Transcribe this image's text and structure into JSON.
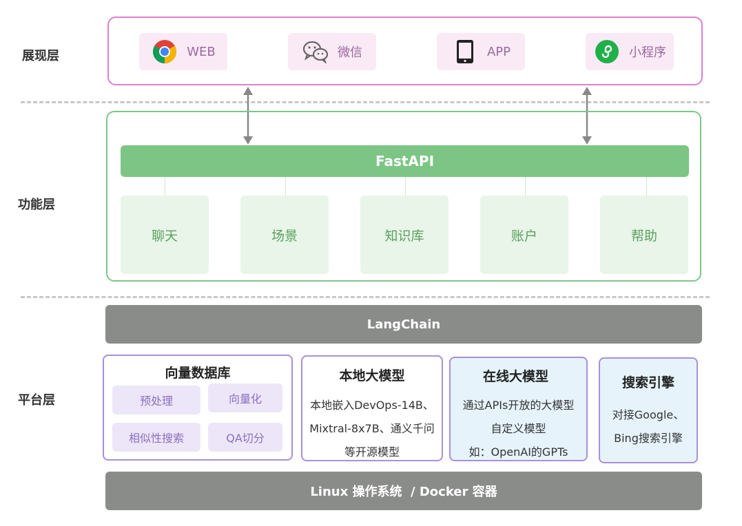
{
  "layers": {
    "presentation": "展现层",
    "function": "功能层",
    "platform": "平台层"
  },
  "presentation": {
    "clients": [
      {
        "label": "WEB",
        "icon": "chrome-icon"
      },
      {
        "label": "微信",
        "icon": "wechat-icon"
      },
      {
        "label": "APP",
        "icon": "mobile-phone-icon"
      },
      {
        "label": "小程序",
        "icon": "mini-program-icon"
      }
    ]
  },
  "function": {
    "api": "FastAPI",
    "modules": [
      "聊天",
      "场景",
      "知识库",
      "账户",
      "帮助"
    ]
  },
  "framework": "LangChain",
  "platform": {
    "vector_db": {
      "title": "向量数据库",
      "items": [
        "预处理",
        "向量化",
        "相似性搜索",
        "QA切分"
      ]
    },
    "local_model": {
      "title": "本地大模型",
      "lines": [
        "本地嵌入DevOps-14B、",
        "Mixtral-8x7B、通义千问",
        "等开源模型"
      ]
    },
    "online_model": {
      "title": "在线大模型",
      "lines": [
        "通过APIs开放的大模型",
        "自定义模型",
        "如：OpenAI的GPTs"
      ]
    },
    "search_engine": {
      "title": "搜索引擎",
      "lines": [
        "对接Google、",
        "Bing搜索引擎"
      ]
    }
  },
  "os": "Linux 操作系统  / Docker 容器",
  "colors": {
    "presentation_border": "#de7fd1",
    "function_border": "#7cc587",
    "fastapi": "#7dc584",
    "grey_bar": "#8a8c8a",
    "platform_border": "#a98fd8"
  }
}
